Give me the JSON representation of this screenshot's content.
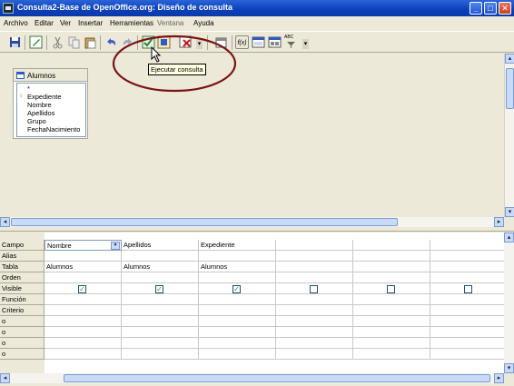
{
  "window": {
    "title": "Consulta2-Base de OpenOffice.org: Diseño de consulta",
    "min_glyph": "_",
    "max_glyph": "□",
    "close_glyph": "✕"
  },
  "menu": {
    "items": [
      "Archivo",
      "Editar",
      "Ver",
      "Insertar",
      "Herramientas",
      "Ventana",
      "Ayuda"
    ]
  },
  "toolbar": {
    "icons": [
      "save-icon",
      "edit-icon",
      "cut-icon",
      "copy-icon",
      "paste-icon",
      "undo-icon",
      "redo-icon",
      "run-query-icon",
      "clear-query-icon",
      "delete-icon",
      "add-table-icon",
      "functions-icon",
      "table-name-icon",
      "alias-icon",
      "distinct-icon"
    ],
    "functions_label": "f(x)",
    "distinct_label": "ABC",
    "dropdown_glyph": "▾"
  },
  "tooltip": {
    "text": "Ejecutar consulta"
  },
  "table_window": {
    "title": "Alumnos",
    "fields": [
      "*",
      "Expediente",
      "Nombre",
      "Apellidos",
      "Grupo",
      "FechaNacimiento"
    ],
    "key_glyph": "♀"
  },
  "scroll_glyphs": {
    "up": "▴",
    "down": "▾",
    "left": "◂",
    "right": "▸"
  },
  "grid": {
    "row_labels": [
      "Campo",
      "Alias",
      "Tabla",
      "Orden",
      "Visible",
      "Función",
      "Criterio",
      "o",
      "o",
      "o",
      "o"
    ],
    "columns": [
      {
        "campo": "Nombre",
        "tabla": "Alumnos",
        "visible": true
      },
      {
        "campo": "Apellidos",
        "tabla": "Alumnos",
        "visible": true
      },
      {
        "campo": "Expediente",
        "tabla": "Alumnos",
        "visible": true
      },
      {
        "campo": "",
        "tabla": "",
        "visible": false
      },
      {
        "campo": "",
        "tabla": "",
        "visible": false
      },
      {
        "campo": "",
        "tabla": "",
        "visible": false
      }
    ],
    "check_glyph": "✓",
    "combo_glyph": "▾"
  },
  "colors": {
    "highlight": "#7a1414",
    "tooltip_bg": "#ffffe1",
    "titlebar": "#0a3fb8"
  }
}
